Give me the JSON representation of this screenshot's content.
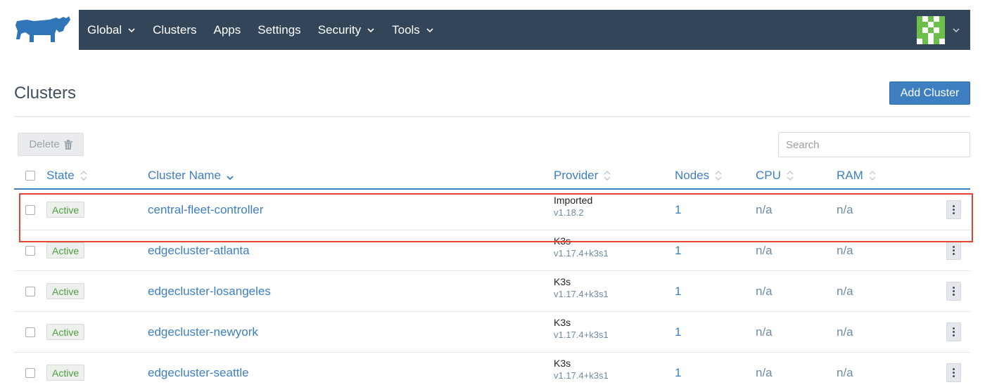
{
  "nav": {
    "items": [
      {
        "label": "Global",
        "dropdown": true
      },
      {
        "label": "Clusters",
        "dropdown": false
      },
      {
        "label": "Apps",
        "dropdown": false
      },
      {
        "label": "Settings",
        "dropdown": false
      },
      {
        "label": "Security",
        "dropdown": true
      },
      {
        "label": "Tools",
        "dropdown": true
      }
    ],
    "logo_icon": "rancher-logo-icon",
    "avatar_icon": "user-avatar-icon"
  },
  "page": {
    "title": "Clusters",
    "add_button": "Add Cluster"
  },
  "toolbar": {
    "delete_label": "Delete",
    "delete_icon": "trash-icon",
    "search_placeholder": "Search"
  },
  "table": {
    "columns": [
      "State",
      "Cluster Name",
      "Provider",
      "Nodes",
      "CPU",
      "RAM"
    ],
    "sorted_column": "Cluster Name",
    "rows": [
      {
        "state": "Active",
        "name": "central-fleet-controller",
        "provider": "Imported",
        "version": "v1.18.2",
        "nodes": "1",
        "cpu": "n/a",
        "ram": "n/a",
        "highlighted": true
      },
      {
        "state": "Active",
        "name": "edgecluster-atlanta",
        "provider": "K3s",
        "version": "v1.17.4+k3s1",
        "nodes": "1",
        "cpu": "n/a",
        "ram": "n/a",
        "highlighted": false
      },
      {
        "state": "Active",
        "name": "edgecluster-losangeles",
        "provider": "K3s",
        "version": "v1.17.4+k3s1",
        "nodes": "1",
        "cpu": "n/a",
        "ram": "n/a",
        "highlighted": false
      },
      {
        "state": "Active",
        "name": "edgecluster-newyork",
        "provider": "K3s",
        "version": "v1.17.4+k3s1",
        "nodes": "1",
        "cpu": "n/a",
        "ram": "n/a",
        "highlighted": false
      },
      {
        "state": "Active",
        "name": "edgecluster-seattle",
        "provider": "K3s",
        "version": "v1.17.4+k3s1",
        "nodes": "1",
        "cpu": "n/a",
        "ram": "n/a",
        "highlighted": false
      }
    ]
  },
  "colors": {
    "nav_bg": "#334559",
    "accent": "#3d7fc1",
    "active_green": "#4a9f3c",
    "highlight_red": "#e34234"
  }
}
